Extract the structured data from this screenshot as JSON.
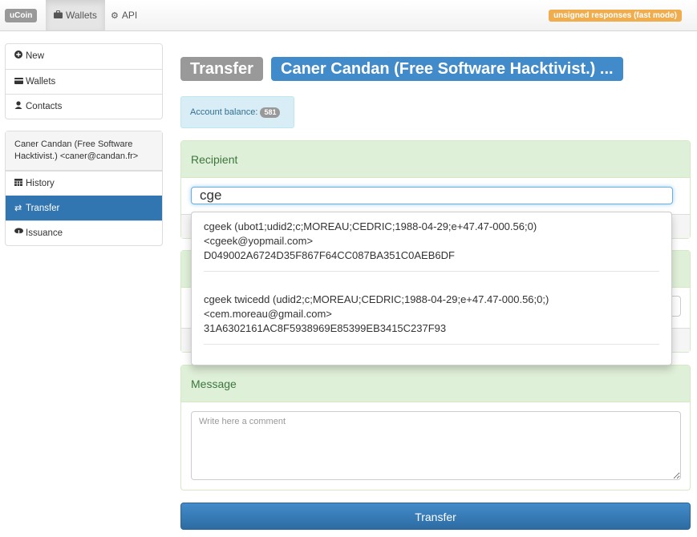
{
  "navbar": {
    "brand": "uCoin",
    "tabs": [
      {
        "label": "Wallets",
        "icon": "briefcase-icon"
      },
      {
        "label": "API",
        "icon": "gear-icon"
      }
    ],
    "mode_badge": "unsigned responses (fast mode)"
  },
  "sidebar": {
    "main_items": [
      {
        "label": "New",
        "icon": "plus-circle-icon"
      },
      {
        "label": "Wallets",
        "icon": "credit-card-icon"
      },
      {
        "label": "Contacts",
        "icon": "user-icon"
      }
    ],
    "wallet_header": "Caner Candan (Free Software Hacktivist.) <caner@candan.fr>",
    "wallet_items": [
      {
        "label": "History",
        "icon": "calendar-icon"
      },
      {
        "label": "Transfer",
        "icon": "transfer-icon",
        "active": true
      },
      {
        "label": "Issuance",
        "icon": "cloud-download-icon"
      }
    ]
  },
  "page": {
    "title": "Transfer",
    "wallet_name": "Caner Candan (Free Software Hacktivist.) ...",
    "balance_label": "Account balance:",
    "balance_value": "581"
  },
  "recipient": {
    "heading": "Recipient",
    "input_value": "cge",
    "suggestions": [
      {
        "line1": "cgeek (ubot1;udid2;c;MOREAU;CEDRIC;1988-04-29;e+47.47-000.56;0)",
        "line2": "<cgeek@yopmail.com>",
        "line3": "D049002A6724D35F867F64CC087BA351C0AEB6DF"
      },
      {
        "line1": "cgeek twicedd (udid2;c;MOREAU;CEDRIC;1988-04-29;e+47.47-000.56;0;)",
        "line2": "<cem.moreau@gmail.com>",
        "line3": "31A6302161AC8F5938969E85399EB3415C237F93"
      }
    ]
  },
  "message": {
    "heading": "Message",
    "placeholder": "Write here a comment"
  },
  "submit_label": "Transfer",
  "colors": {
    "primary": "#428bca",
    "active_item": "#3276b1",
    "success_bg": "#dff0d8",
    "success_text": "#3c763d",
    "info_bg": "#d9edf7",
    "warning": "#f0ad4e"
  }
}
